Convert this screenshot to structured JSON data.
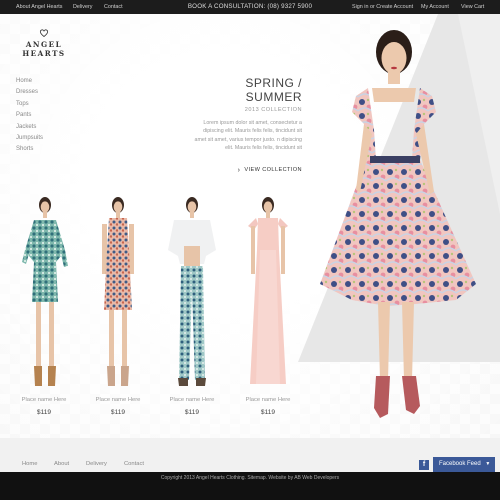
{
  "topbar": {
    "left_links": [
      "About Angel Hearts",
      "Delivery",
      "Contact"
    ],
    "consult": "BOOK A CONSULTATION: (08) 9327 5900",
    "right_links": [
      "Sign in or Create Account",
      "My Account",
      "View Cart"
    ]
  },
  "brand": {
    "name": "ANGEL HEARTS",
    "logo_icon": "heart-outline-icon"
  },
  "nav": {
    "items": [
      "Home",
      "Dresses",
      "Tops",
      "Pants",
      "Jackets",
      "Jumpsuits",
      "Shorts"
    ]
  },
  "promo": {
    "title": "SPRING / SUMMER",
    "subtitle": "2013 COLLECTION",
    "body": "Lorem ipsum dolor sit amet, consectetur a dipiscing elit. Mauris felis felis, tincidunt sit amet sit amet, varius tempor justo. n dipiscing elit. Mauris felis felis, tincidunt sit",
    "cta": "VIEW COLLECTION",
    "cta_icon": "chevron-right-icon"
  },
  "products": [
    {
      "name": "Place name Here",
      "price": "$119",
      "palette": "teal-print"
    },
    {
      "name": "Place name Here",
      "price": "$119",
      "palette": "coral-print"
    },
    {
      "name": "Place name Here",
      "price": "$119",
      "palette": "teal-pants"
    },
    {
      "name": "Place name Here",
      "price": "$119",
      "palette": "blush-gown"
    }
  ],
  "footer": {
    "links": [
      "Home",
      "About",
      "Delivery",
      "Contact"
    ],
    "facebook_icon": "facebook-icon",
    "facebook_feed": "Facebook Feed",
    "facebook_chevron": "chevron-down-icon",
    "copyright": "Copyright 2013 Angel Hearts Clothing. Sitemap. Website by AB Web Developers"
  },
  "colors": {
    "topbar": "#1c1c1c",
    "facebook": "#3b5998",
    "accent_text": "#444444"
  }
}
